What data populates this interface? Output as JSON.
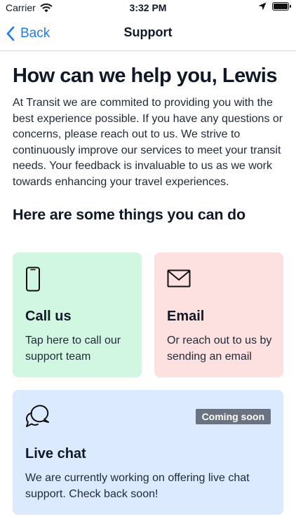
{
  "status": {
    "carrier": "Carrier",
    "time": "3:32 PM"
  },
  "nav": {
    "back_label": "Back",
    "title": "Support"
  },
  "main": {
    "headline": "How can we help you, Lewis",
    "intro": "At Transit we are commited to providing you with the best experience possible. If you have any questions or concerns, please reach out to us. We strive to continuously improve our services to meet your transit needs. Your feedback is invaluable to us as we work towards enhancing your travel experiences.",
    "section_title": "Here are some things you can do"
  },
  "cards": {
    "call": {
      "title": "Call us",
      "description": "Tap here to call our support team",
      "icon": "phone-icon",
      "color": "#d1f7e2"
    },
    "email": {
      "title": "Email",
      "description": "Or reach out to us by sending an email",
      "icon": "envelope-icon",
      "color": "#fde1e1"
    },
    "chat": {
      "title": "Live chat",
      "description": "We are currently working on offering live chat support. Check back soon!",
      "badge": "Coming soon",
      "icon": "chat-bubbles-icon",
      "color": "#dbeafe"
    }
  },
  "colors": {
    "accent": "#1e7cf5",
    "badge": "#6b7280"
  }
}
